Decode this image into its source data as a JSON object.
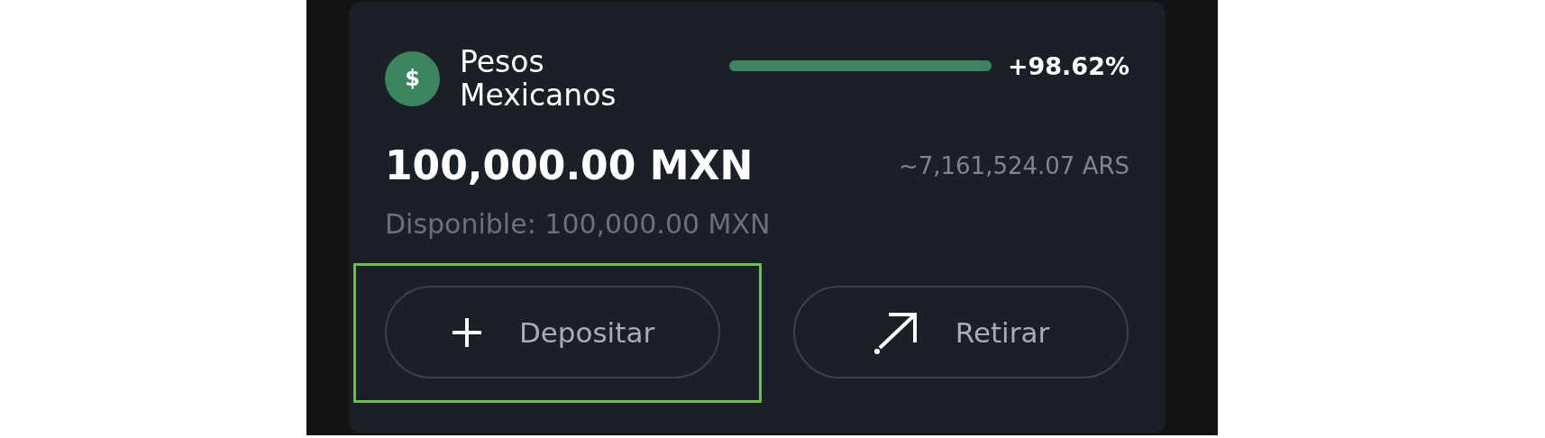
{
  "account": {
    "currency_name": "Pesos Mexicanos",
    "icon_symbol": "$",
    "change": {
      "level": 1,
      "reading": "+98.62%"
    },
    "balance": "100,000.00 MXN",
    "converted": "~7,161,524.07 ARS",
    "available": "Disponible: 100,000.00 MXN"
  },
  "actions": [
    {
      "kind": "deposit",
      "label": "Depositar",
      "highlighted": true
    },
    {
      "kind": "withdraw",
      "label": "Retirar",
      "highlighted": false
    }
  ]
}
